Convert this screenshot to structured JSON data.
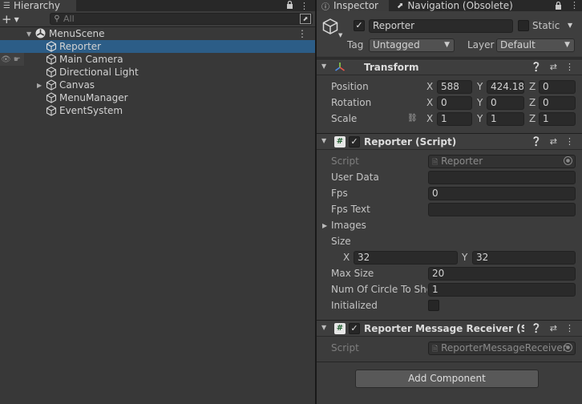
{
  "hierarchy": {
    "tab_title": "Hierarchy",
    "icons": {
      "tab": "list-icon",
      "lock": "lock-icon",
      "menu": "kebab-menu-icon",
      "add": "plus-icon"
    },
    "search_placeholder": "All",
    "scene": {
      "name": "MenuScene"
    },
    "items": [
      {
        "label": "Reporter",
        "selected": true,
        "expandable": false
      },
      {
        "label": "Main Camera",
        "selected": false,
        "expandable": false
      },
      {
        "label": "Directional Light",
        "selected": false,
        "expandable": false
      },
      {
        "label": "Canvas",
        "selected": false,
        "expandable": true
      },
      {
        "label": "MenuManager",
        "selected": false,
        "expandable": false
      },
      {
        "label": "EventSystem",
        "selected": false,
        "expandable": false
      }
    ]
  },
  "inspector": {
    "tabs": [
      {
        "label": "Inspector",
        "icon": "info-icon",
        "active": true
      },
      {
        "label": "Navigation (Obsolete)",
        "icon": "compass-icon",
        "active": false
      }
    ],
    "object": {
      "name": "Reporter",
      "active": true,
      "static_label": "Static",
      "tag_label": "Tag",
      "tag_value": "Untagged",
      "layer_label": "Layer",
      "layer_value": "Default"
    },
    "transform": {
      "title": "Transform",
      "rows": [
        {
          "label": "Position",
          "x": "588",
          "y": "424.18",
          "z": "0"
        },
        {
          "label": "Rotation",
          "x": "0",
          "y": "0",
          "z": "0"
        },
        {
          "label": "Scale",
          "x": "1",
          "y": "1",
          "z": "1"
        }
      ]
    },
    "reporter_script": {
      "title": "Reporter (Script)",
      "script_label": "Script",
      "script_value": "Reporter",
      "user_data_label": "User Data",
      "user_data_value": "",
      "fps_label": "Fps",
      "fps_value": "0",
      "fps_text_label": "Fps Text",
      "fps_text_value": "",
      "images_label": "Images",
      "size_label": "Size",
      "size_x": "32",
      "size_y": "32",
      "max_size_label": "Max Size",
      "max_size_value": "20",
      "num_circle_label": "Num Of Circle To Sho",
      "num_circle_value": "1",
      "initialized_label": "Initialized"
    },
    "receiver_script": {
      "title": "Reporter Message Receiver (Scrip",
      "script_label": "Script",
      "script_value": "ReporterMessageReceiver"
    },
    "add_component_label": "Add Component",
    "axes": {
      "x": "X",
      "y": "Y",
      "z": "Z"
    }
  }
}
